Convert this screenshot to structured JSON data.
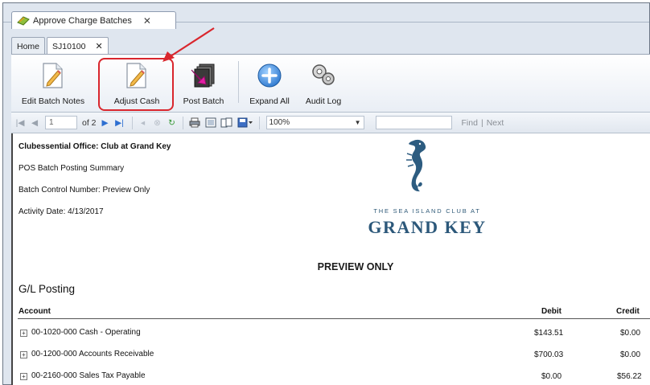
{
  "window": {
    "doc_tab_title": "Approve Charge Batches",
    "doc_tab_close": "✕"
  },
  "tabs": [
    {
      "label": "Home"
    },
    {
      "label": "SJ10100",
      "close": "✕"
    }
  ],
  "ribbon": {
    "buttons": [
      {
        "label": "Edit Batch Notes",
        "icon": "edit-notes-icon"
      },
      {
        "label": "Adjust Cash",
        "icon": "adjust-cash-icon"
      },
      {
        "label": "Post Batch",
        "icon": "post-batch-icon"
      },
      {
        "label": "Expand All",
        "icon": "expand-all-icon"
      },
      {
        "label": "Audit Log",
        "icon": "audit-log-icon"
      }
    ]
  },
  "navbar": {
    "page_value": "1",
    "page_of": "of 2",
    "zoom_value": "100%",
    "find_label": "Find",
    "next_label": "Next",
    "divider": "|"
  },
  "report": {
    "office": "Clubessential Office: Club at Grand Key",
    "summary": "POS Batch Posting Summary",
    "batch_control": "Batch Control Number: Preview Only",
    "activity_date": "Activity Date: 4/13/2017",
    "club_tagline": "THE SEA ISLAND CLUB AT",
    "club_name": "GRAND KEY",
    "preview": "PREVIEW ONLY",
    "section_title": "G/L Posting",
    "columns": {
      "account": "Account",
      "debit": "Debit",
      "credit": "Credit"
    },
    "rows": [
      {
        "account": "00-1020-000 Cash - Operating",
        "debit": "$143.51",
        "credit": "$0.00"
      },
      {
        "account": "00-1200-000 Accounts Receivable",
        "debit": "$700.03",
        "credit": "$0.00"
      },
      {
        "account": "00-2160-000 Sales Tax Payable",
        "debit": "$0.00",
        "credit": "$56.22"
      }
    ]
  },
  "colors": {
    "highlight": "#d9262d",
    "club_blue": "#2c587a"
  }
}
